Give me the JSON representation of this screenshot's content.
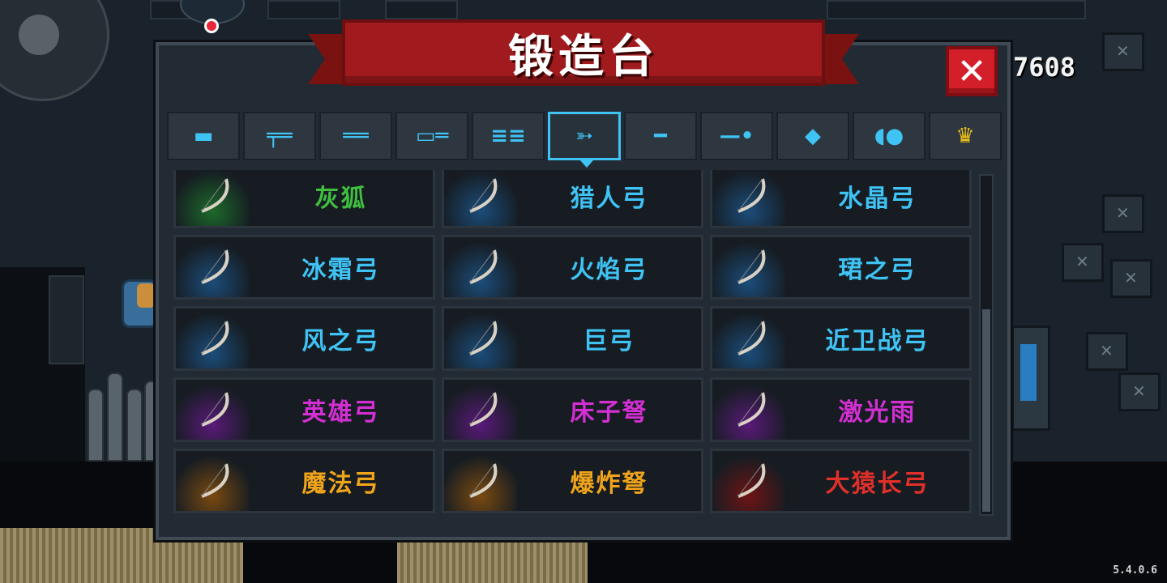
{
  "title": "锻造台",
  "currency": {
    "gems": "7608",
    "icon": "gem-icon"
  },
  "version": "5.4.0.6",
  "close_icon": "close-icon",
  "tabs": [
    {
      "icon": "pistol-icon",
      "glyph": "▬",
      "active": false
    },
    {
      "icon": "assault-rifle-icon",
      "glyph": "╤═",
      "active": false
    },
    {
      "icon": "shotgun-icon",
      "glyph": "══",
      "active": false
    },
    {
      "icon": "launcher-icon",
      "glyph": "▭═",
      "active": false
    },
    {
      "icon": "laser-icon",
      "glyph": "≡≡",
      "active": false
    },
    {
      "icon": "bow-icon",
      "glyph": "➳",
      "active": true
    },
    {
      "icon": "sword-icon",
      "glyph": "━",
      "active": false
    },
    {
      "icon": "spear-icon",
      "glyph": "—•",
      "active": false
    },
    {
      "icon": "shuriken-icon",
      "glyph": "◆",
      "active": false
    },
    {
      "icon": "fish-icon",
      "glyph": "◖●",
      "active": false
    },
    {
      "icon": "crown-icon",
      "glyph": "♛",
      "active": false,
      "gold": true
    }
  ],
  "items": [
    {
      "name": "灰狐",
      "color": "#3fbe3f",
      "glow": "#1c6a2a"
    },
    {
      "name": "猎人弓",
      "color": "#3fc3f4",
      "glow": "#1b4d7a"
    },
    {
      "name": "水晶弓",
      "color": "#3fc3f4",
      "glow": "#1b4d7a"
    },
    {
      "name": "冰霜弓",
      "color": "#3fc3f4",
      "glow": "#1b4d7a"
    },
    {
      "name": "火焰弓",
      "color": "#3fc3f4",
      "glow": "#1b4d7a"
    },
    {
      "name": "珺之弓",
      "color": "#3fc3f4",
      "glow": "#1b4d7a"
    },
    {
      "name": "风之弓",
      "color": "#3fc3f4",
      "glow": "#1b4d7a"
    },
    {
      "name": "巨弓",
      "color": "#3fc3f4",
      "glow": "#1b4d7a"
    },
    {
      "name": "近卫战弓",
      "color": "#3fc3f4",
      "glow": "#1b4d7a"
    },
    {
      "name": "英雄弓",
      "color": "#d42fd4",
      "glow": "#5a1a7a"
    },
    {
      "name": "床子弩",
      "color": "#d42fd4",
      "glow": "#5a1a7a"
    },
    {
      "name": "激光雨",
      "color": "#d42fd4",
      "glow": "#5a1a7a"
    },
    {
      "name": "魔法弓",
      "color": "#f0a41b",
      "glow": "#7a4a10"
    },
    {
      "name": "爆炸弩",
      "color": "#f0a41b",
      "glow": "#7a4a10"
    },
    {
      "name": "大猿长弓",
      "color": "#e0302a",
      "glow": "#6e1414"
    }
  ]
}
